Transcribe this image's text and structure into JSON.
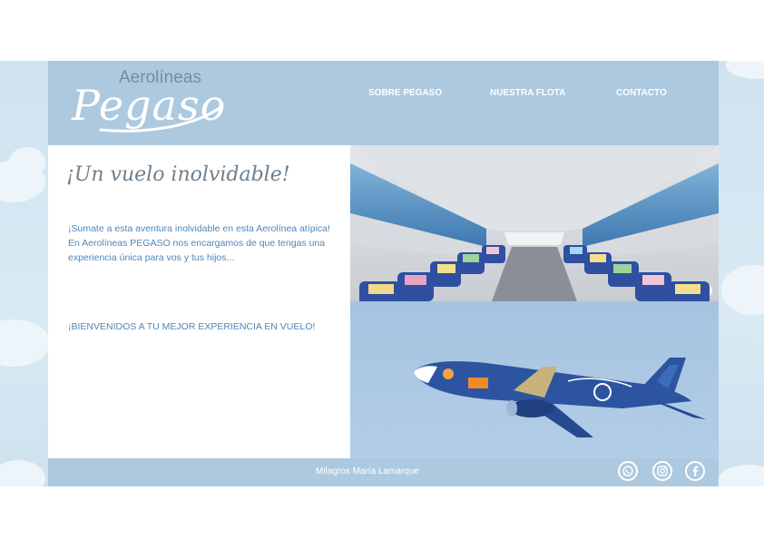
{
  "brand": {
    "name_top": "Aerolíneas",
    "name_script": "Pegaso"
  },
  "nav": {
    "items": [
      {
        "label": "SOBRE PEGASO"
      },
      {
        "label": "NUESTRA FLOTA"
      },
      {
        "label": "CONTACTO"
      }
    ]
  },
  "main": {
    "headline": "¡Un vuelo inolvidable!",
    "intro": "¡Sumate a esta aventura inolvidable en esta Aerolínea atípica! En Aerolíneas PEGASO nos encargamos de que tengas una experiencia única para vos y tus hijos...",
    "welcome": "¡BIENVENIDOS A TU MEJOR EXPERIENCIA EN VUELO!"
  },
  "footer": {
    "credit": "Milagros María Lamarque",
    "social": [
      {
        "icon": "whatsapp-icon"
      },
      {
        "icon": "instagram-icon"
      },
      {
        "icon": "facebook-icon"
      }
    ]
  },
  "colors": {
    "header": "#adc9df",
    "text_blue": "#4f86b7",
    "headline_grey": "#6f7f8c"
  }
}
